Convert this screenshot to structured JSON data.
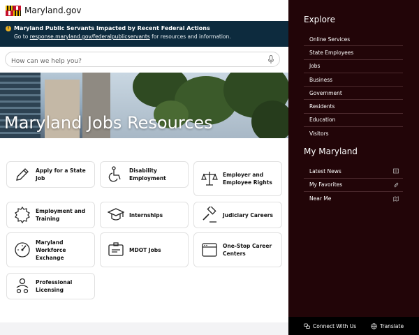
{
  "header": {
    "site_name": "Maryland.gov"
  },
  "alert": {
    "icon": "alert-circle-icon",
    "title": "Maryland Public Servants Impacted by Recent Federal Actions",
    "text_prefix": "Go to",
    "link_text": "response.maryland.gov/federalpublicservants",
    "text_suffix": "for resources and information.",
    "background_color": "#0d2b3e",
    "icon_color": "#f0b323"
  },
  "search": {
    "placeholder": "How can we help you?",
    "value": ""
  },
  "hero": {
    "title": "Maryland Jobs Resources"
  },
  "cards": [
    {
      "label": "Apply for a State Job",
      "icon": "pencil-icon"
    },
    {
      "label": "Disability Employment",
      "icon": "wheelchair-icon"
    },
    {
      "label": "Employer and Employee Rights",
      "icon": "scales-icon"
    },
    {
      "label": "Employment and Training",
      "icon": "badge-icon"
    },
    {
      "label": "Internships",
      "icon": "graduation-cap-icon"
    },
    {
      "label": "Judiciary Careers",
      "icon": "gavel-icon"
    },
    {
      "label": "Maryland Workforce Exchange",
      "icon": "gauge-icon"
    },
    {
      "label": "MDOT Jobs",
      "icon": "id-card-icon"
    },
    {
      "label": "One-Stop Career Centers",
      "icon": "browser-window-icon"
    },
    {
      "label": "Professional Licensing",
      "icon": "user-group-icon"
    }
  ],
  "panel": {
    "background_color": "#220508",
    "explore_heading": "Explore",
    "explore_items": [
      "Online Services",
      "State Employees",
      "Jobs",
      "Business",
      "Government",
      "Residents",
      "Education",
      "Visitors"
    ],
    "my_maryland_heading": "My Maryland",
    "my_maryland_items": [
      {
        "label": "Latest News",
        "icon": "newspaper-icon"
      },
      {
        "label": "My Favorites",
        "icon": "paperclip-icon"
      },
      {
        "label": "Near Me",
        "icon": "map-icon"
      }
    ],
    "connect_label": "Connect With Us",
    "connect_icon": "chat-bubbles-icon",
    "translate_label": "Translate",
    "translate_icon": "globe-icon"
  }
}
